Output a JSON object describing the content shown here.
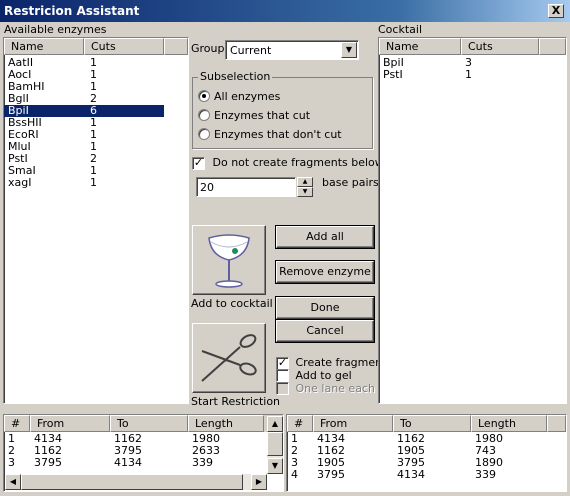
{
  "window": {
    "title": "Restricion Assistant",
    "close_glyph": "X"
  },
  "available": {
    "title": "Available enzymes",
    "columns": [
      "Name",
      "Cuts"
    ],
    "rows": [
      {
        "name": "AatII",
        "cuts": "1"
      },
      {
        "name": "AocI",
        "cuts": "1"
      },
      {
        "name": "BamHI",
        "cuts": "1"
      },
      {
        "name": "BglI",
        "cuts": "2"
      },
      {
        "name": "BpiI",
        "cuts": "6"
      },
      {
        "name": "BssHII",
        "cuts": "1"
      },
      {
        "name": "EcoRI",
        "cuts": "1"
      },
      {
        "name": "MluI",
        "cuts": "1"
      },
      {
        "name": "PstI",
        "cuts": "2"
      },
      {
        "name": "SmaI",
        "cuts": "1"
      },
      {
        "name": "xagI",
        "cuts": "1"
      }
    ],
    "selected_row": "BpiI"
  },
  "cocktail": {
    "title": "Cocktail",
    "columns": [
      "Name",
      "Cuts"
    ],
    "rows": [
      {
        "name": "BpiI",
        "cuts": "3"
      },
      {
        "name": "PstI",
        "cuts": "1"
      }
    ]
  },
  "group": {
    "label": "Group",
    "value": "Current"
  },
  "subselection": {
    "legend": "Subselection",
    "options": [
      "All enzymes",
      "Enzymes that cut",
      "Enzymes that don't cut"
    ],
    "selected": "All enzymes"
  },
  "fragments_min": {
    "checkbox_label": "Do not create fragments below",
    "checked": true,
    "value": "20",
    "unit_label": "base pairs."
  },
  "buttons": {
    "add_all": "Add all",
    "remove_enzyme": "Remove enzyme",
    "done": "Done",
    "cancel": "Cancel",
    "add_to_cocktail": "Add to cocktail",
    "start_restriction": "Start Restriction"
  },
  "options": {
    "create_fragments": {
      "label": "Create fragments",
      "checked": true
    },
    "add_to_gel": {
      "label": "Add to gel",
      "checked": false
    },
    "one_lane_each": {
      "label": "One lane each",
      "checked": false,
      "disabled": true
    }
  },
  "fragments_left": {
    "columns": [
      "#",
      "From",
      "To",
      "Length"
    ],
    "rows": [
      [
        "1",
        "4134",
        "1162",
        "1980"
      ],
      [
        "2",
        "1162",
        "3795",
        "2633"
      ],
      [
        "3",
        "3795",
        "4134",
        "339"
      ]
    ]
  },
  "fragments_right": {
    "columns": [
      "#",
      "From",
      "To",
      "Length"
    ],
    "rows": [
      [
        "1",
        "4134",
        "1162",
        "1980"
      ],
      [
        "2",
        "1162",
        "1905",
        "743"
      ],
      [
        "3",
        "1905",
        "3795",
        "1890"
      ],
      [
        "4",
        "3795",
        "4134",
        "339"
      ]
    ]
  },
  "icons": {
    "cocktail": "cocktail-glass-icon",
    "scissors": "scissors-icon",
    "dropdown": "chevron-down-icon",
    "close": "close-icon"
  },
  "colors": {
    "selection": "#0a246a",
    "olive": "#1a8f5a"
  }
}
